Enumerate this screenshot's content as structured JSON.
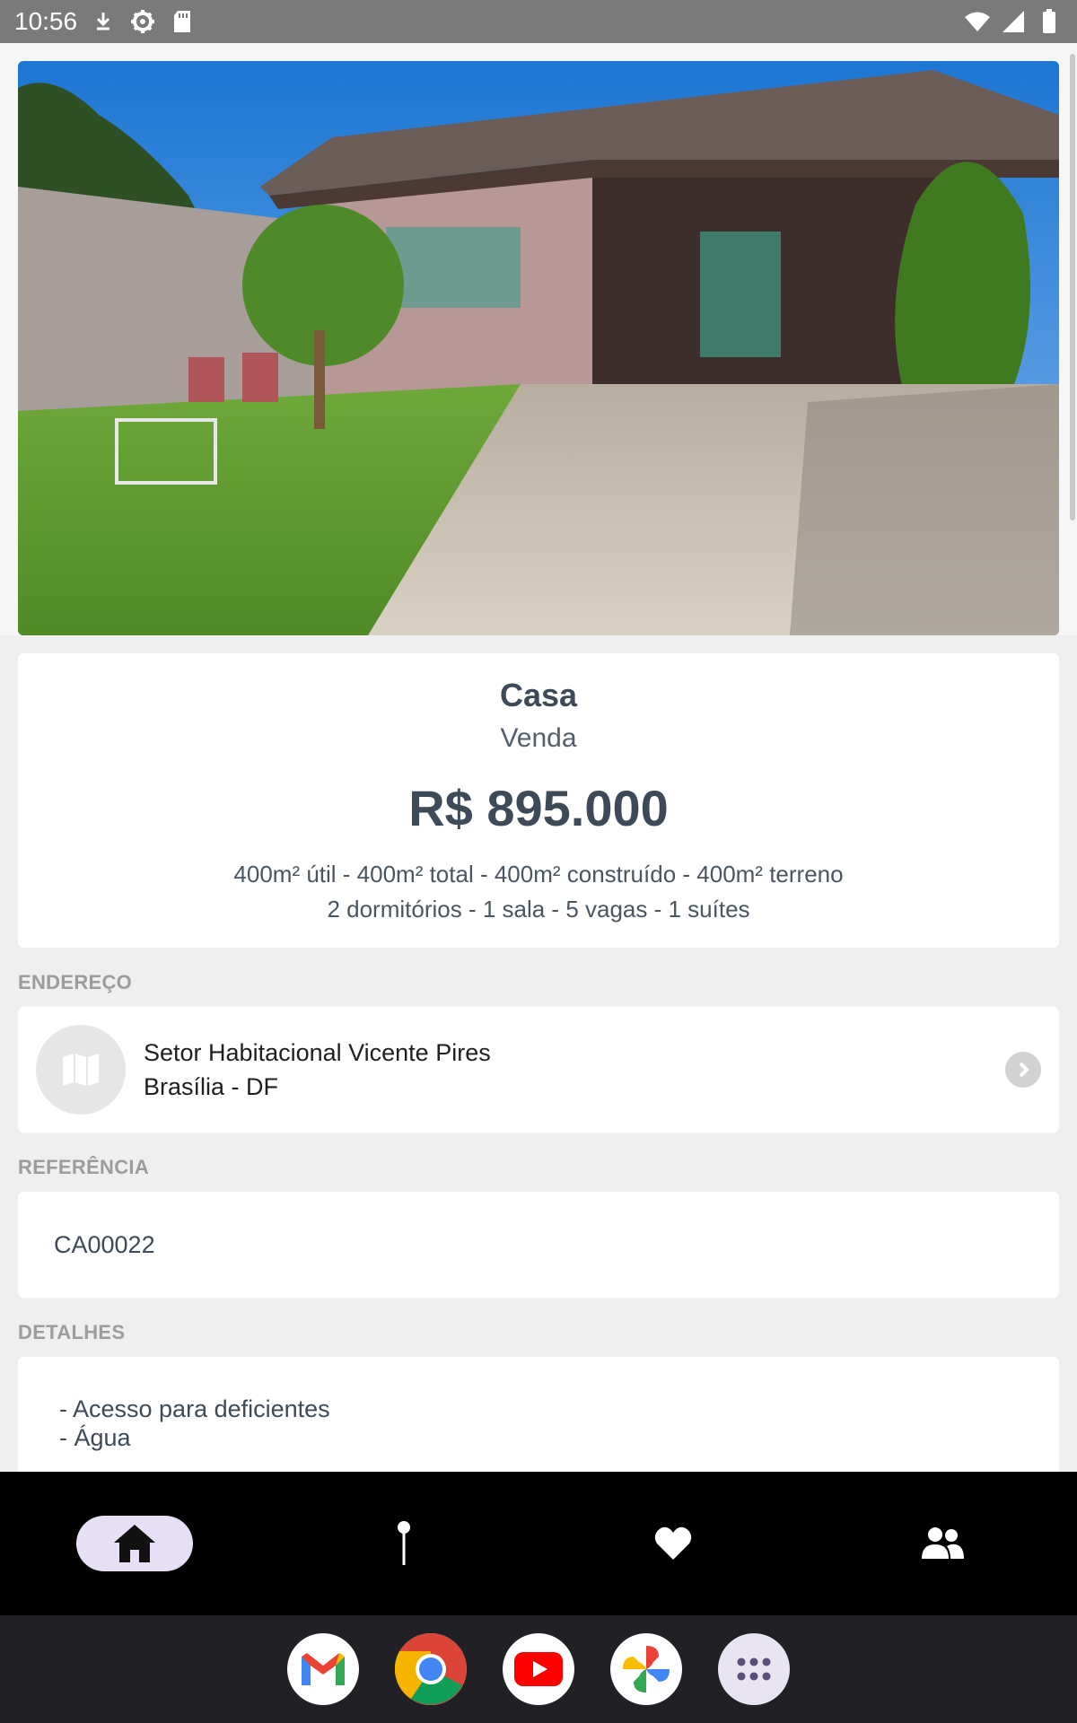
{
  "status_bar": {
    "time": "10:56",
    "icons_left": [
      "download-icon",
      "settings-icon",
      "sd-card-icon"
    ],
    "icons_right": [
      "wifi-icon",
      "cell-signal-icon",
      "battery-icon"
    ]
  },
  "listing": {
    "type": "Casa",
    "deal": "Venda",
    "price": "R$ 895.000",
    "areas": "400m² útil - 400m² total - 400m² construído - 400m² terreno",
    "rooms": "2 dormitórios - 1 sala - 5 vagas - 1 suítes"
  },
  "address_section": {
    "label": "ENDEREÇO",
    "line1": "Setor Habitacional Vicente Pires",
    "line2": "Brasília - DF"
  },
  "reference_section": {
    "label": "REFERÊNCIA",
    "code": "CA00022"
  },
  "details_section": {
    "label": "DETALHES",
    "items": [
      "- Acesso para deficientes",
      "- Água"
    ]
  },
  "bottom_nav": {
    "items": [
      {
        "icon": "home-icon",
        "active": true
      },
      {
        "icon": "map-pin-icon",
        "active": false
      },
      {
        "icon": "heart-icon",
        "active": false
      },
      {
        "icon": "people-icon",
        "active": false
      }
    ]
  },
  "dock": {
    "apps": [
      "gmail-icon",
      "chrome-icon",
      "youtube-icon",
      "photos-icon",
      "app-drawer-icon"
    ]
  },
  "colors": {
    "text_primary": "#3e4a58",
    "nav_active_bg": "#e7dff6",
    "status_bar": "#7a7a7a"
  }
}
